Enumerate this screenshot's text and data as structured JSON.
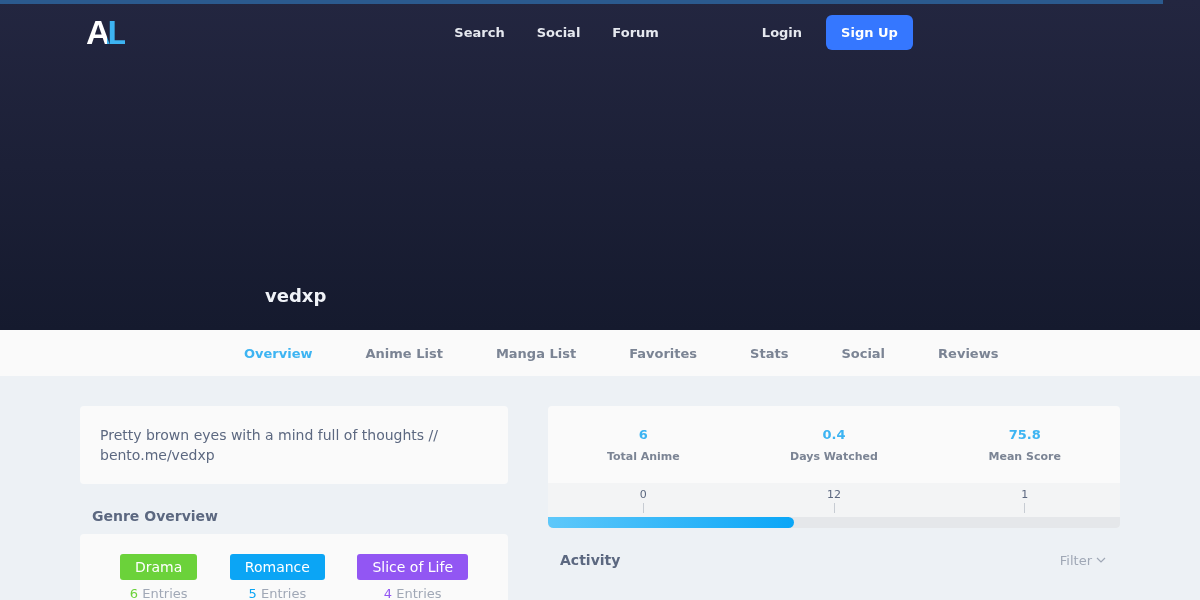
{
  "header": {
    "logo": "AL",
    "nav": [
      "Search",
      "Social",
      "Forum"
    ],
    "login": "Login",
    "signup": "Sign Up"
  },
  "profile": {
    "username": "vedxp"
  },
  "tabs": [
    {
      "label": "Overview",
      "selected": true
    },
    {
      "label": "Anime List",
      "selected": false
    },
    {
      "label": "Manga List",
      "selected": false
    },
    {
      "label": "Favorites",
      "selected": false
    },
    {
      "label": "Stats",
      "selected": false
    },
    {
      "label": "Social",
      "selected": false
    },
    {
      "label": "Reviews",
      "selected": false
    }
  ],
  "bio": "Pretty brown eyes with a mind full of thoughts // bento.me/vedxp",
  "genre_overview": {
    "title": "Genre Overview",
    "genres": [
      {
        "name": "Drama",
        "count": "6",
        "unit": "Entries",
        "color": "#6bd23a"
      },
      {
        "name": "Romance",
        "count": "5",
        "unit": "Entries",
        "color": "#0ba5f5"
      },
      {
        "name": "Slice of Life",
        "count": "4",
        "unit": "Entries",
        "color": "#9256f3"
      }
    ]
  },
  "stats": [
    {
      "value": "6",
      "label": "Total Anime"
    },
    {
      "value": "0.4",
      "label": "Days Watched"
    },
    {
      "value": "75.8",
      "label": "Mean Score"
    }
  ],
  "progress": {
    "ticks": [
      "0",
      "12",
      "1"
    ],
    "level": 0.43
  },
  "activity": {
    "title": "Activity",
    "filter": "Filter"
  }
}
